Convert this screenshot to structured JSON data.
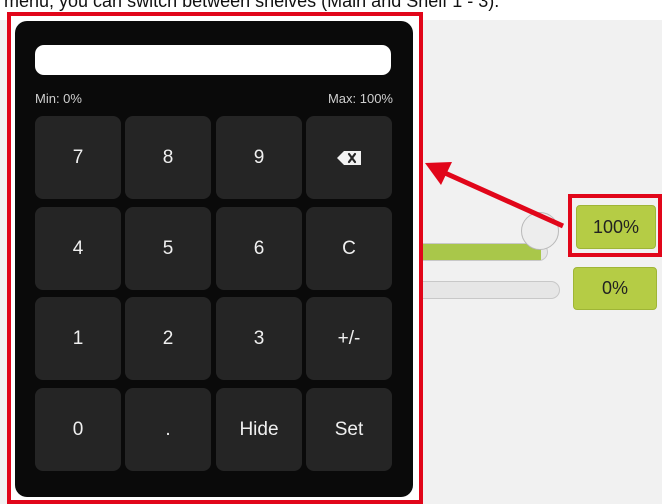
{
  "caption": "menu, you can switch between shelves (Main and Shelf 1 - 3).",
  "keypad": {
    "display_value": "",
    "min_label": "Min: 0%",
    "max_label": "Max: 100%",
    "keys": [
      {
        "label": "7",
        "name": "key-7"
      },
      {
        "label": "8",
        "name": "key-8"
      },
      {
        "label": "9",
        "name": "key-9"
      },
      {
        "label": "",
        "name": "backspace-key",
        "icon": "backspace-icon"
      },
      {
        "label": "4",
        "name": "key-4"
      },
      {
        "label": "5",
        "name": "key-5"
      },
      {
        "label": "6",
        "name": "key-6"
      },
      {
        "label": "C",
        "name": "clear-key"
      },
      {
        "label": "1",
        "name": "key-1"
      },
      {
        "label": "2",
        "name": "key-2"
      },
      {
        "label": "3",
        "name": "key-3"
      },
      {
        "label": "+/-",
        "name": "sign-toggle-key"
      },
      {
        "label": "0",
        "name": "key-0"
      },
      {
        "label": ".",
        "name": "decimal-key"
      },
      {
        "label": "Hide",
        "name": "hide-key"
      },
      {
        "label": "Set",
        "name": "set-key"
      }
    ]
  },
  "sliders": [
    {
      "value_label": "100%",
      "fill": 1.0
    },
    {
      "value_label": "0%",
      "fill": 0.0
    }
  ],
  "colors": {
    "highlight": "#e1061a",
    "value_box": "#b5cc45",
    "slider_fill": "#a9c74a",
    "keypad_bg": "#0a0a0a",
    "key_bg": "#252525"
  }
}
